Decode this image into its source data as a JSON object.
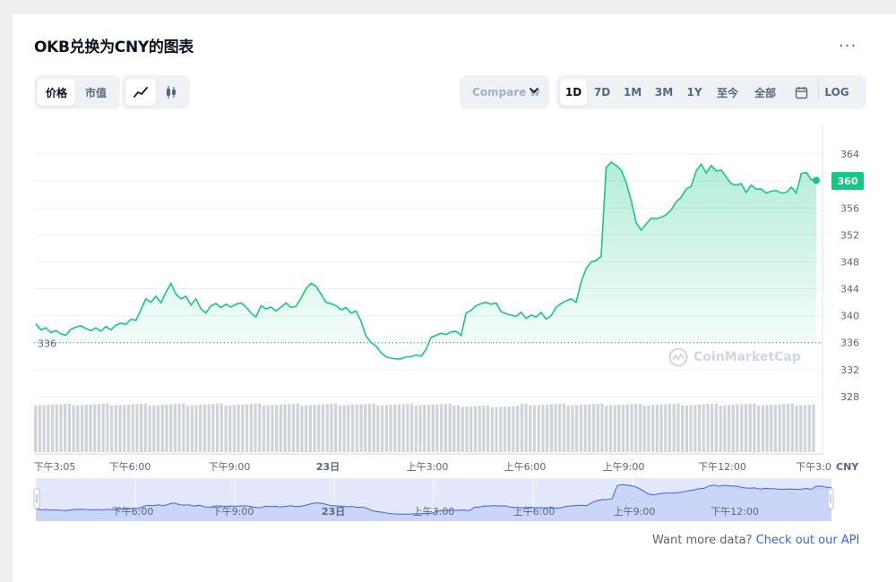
{
  "chart_title": "OKB兑换为CNY的图表",
  "more_label": "...",
  "type_tabs": [
    {
      "label": "价格",
      "active": true
    },
    {
      "label": "市值",
      "active": false
    }
  ],
  "view_icons": [
    {
      "name": "line-chart-icon",
      "active": true
    },
    {
      "name": "candlestick-icon",
      "active": false
    }
  ],
  "compare_label": "Compare w",
  "range_tabs": [
    {
      "label": "1D",
      "active": true
    },
    {
      "label": "7D",
      "active": false
    },
    {
      "label": "1M",
      "active": false
    },
    {
      "label": "3M",
      "active": false
    },
    {
      "label": "1Y",
      "active": false
    },
    {
      "label": "至今",
      "active": false
    },
    {
      "label": "全部",
      "active": false
    }
  ],
  "log_label": "LOG",
  "currency_label": "CNY",
  "watermark": "CoinMarketCap",
  "footer": {
    "text": "Want more data? ",
    "link": "Check out our API"
  },
  "colors": {
    "up": "#16c784",
    "down": "#ea3943",
    "accent": "#3861fb",
    "text": "#0d1421",
    "muted": "#58667e"
  },
  "chart_data": {
    "type": "line",
    "y_ticks": [
      364,
      360,
      356,
      352,
      348,
      344,
      340,
      336,
      332,
      328
    ],
    "ylim": [
      324,
      368
    ],
    "baseline": 336,
    "baseline_label": "336",
    "current_price": 360,
    "current_label": "360",
    "x_ticks": [
      "下午3:05",
      "下午6:00",
      "下午9:00",
      "23日",
      "上午3:00",
      "上午6:00",
      "上午9:00",
      "下午12:00",
      "下午3:0"
    ],
    "navigator_ticks": [
      "下午6:00",
      "下午9:00",
      "23日",
      "上午3:00",
      "上午6:00",
      "上午9:00",
      "下午12:00"
    ],
    "series": [
      {
        "values": [
          338.8,
          337.9,
          338.2,
          337.5,
          337.8,
          337.3,
          337.1,
          338.0,
          338.3,
          338.5,
          338.1,
          337.8,
          338.2,
          337.7,
          338.4,
          337.9,
          338.6,
          338.9,
          338.7,
          339.5,
          339.3,
          340.9,
          342.5,
          342.0,
          342.9,
          341.9,
          343.5,
          344.8,
          343.2,
          342.5,
          342.9,
          341.6,
          342.5,
          341.0,
          340.4,
          341.5,
          341.8,
          341.2,
          341.7,
          341.3,
          341.7,
          341.9,
          341.3,
          340.4,
          339.8,
          341.5,
          341.0,
          341.3,
          340.7,
          341.3,
          341.9,
          341.2,
          341.4,
          342.6,
          344.0,
          344.8,
          344.4,
          343.2,
          342.0,
          341.8,
          341.5,
          340.9,
          341.2,
          340.4,
          340.7,
          339.2,
          337.0,
          336.0,
          335.5,
          334.5,
          333.9,
          333.7,
          333.6,
          333.6,
          333.9,
          333.9,
          334.2,
          334.0,
          335.0,
          336.8,
          337.1,
          337.4,
          337.2,
          337.6,
          337.7,
          337.1,
          340.4,
          340.8,
          341.5,
          341.8,
          342.0,
          341.7,
          341.9,
          340.6,
          340.3,
          340.1,
          339.9,
          340.5,
          339.6,
          340.1,
          339.8,
          340.5,
          339.5,
          340.0,
          341.3,
          341.8,
          342.2,
          342.5,
          342.0,
          345.0,
          347.0,
          348.0,
          348.2,
          348.8,
          362.0,
          362.8,
          362.3,
          361.6,
          359.8,
          357.1,
          353.8,
          352.7,
          353.6,
          354.5,
          354.4,
          354.6,
          355.0,
          355.7,
          356.9,
          357.6,
          358.8,
          359.2,
          361.5,
          362.5,
          361.2,
          362.3,
          361.5,
          361.6,
          360.6,
          359.6,
          359.4,
          359.6,
          358.3,
          359.4,
          358.8,
          358.8,
          358.2,
          358.5,
          358.6,
          358.2,
          358.3,
          359.1,
          358.2,
          361.1,
          361.3,
          360.2,
          360.1
        ]
      }
    ]
  }
}
